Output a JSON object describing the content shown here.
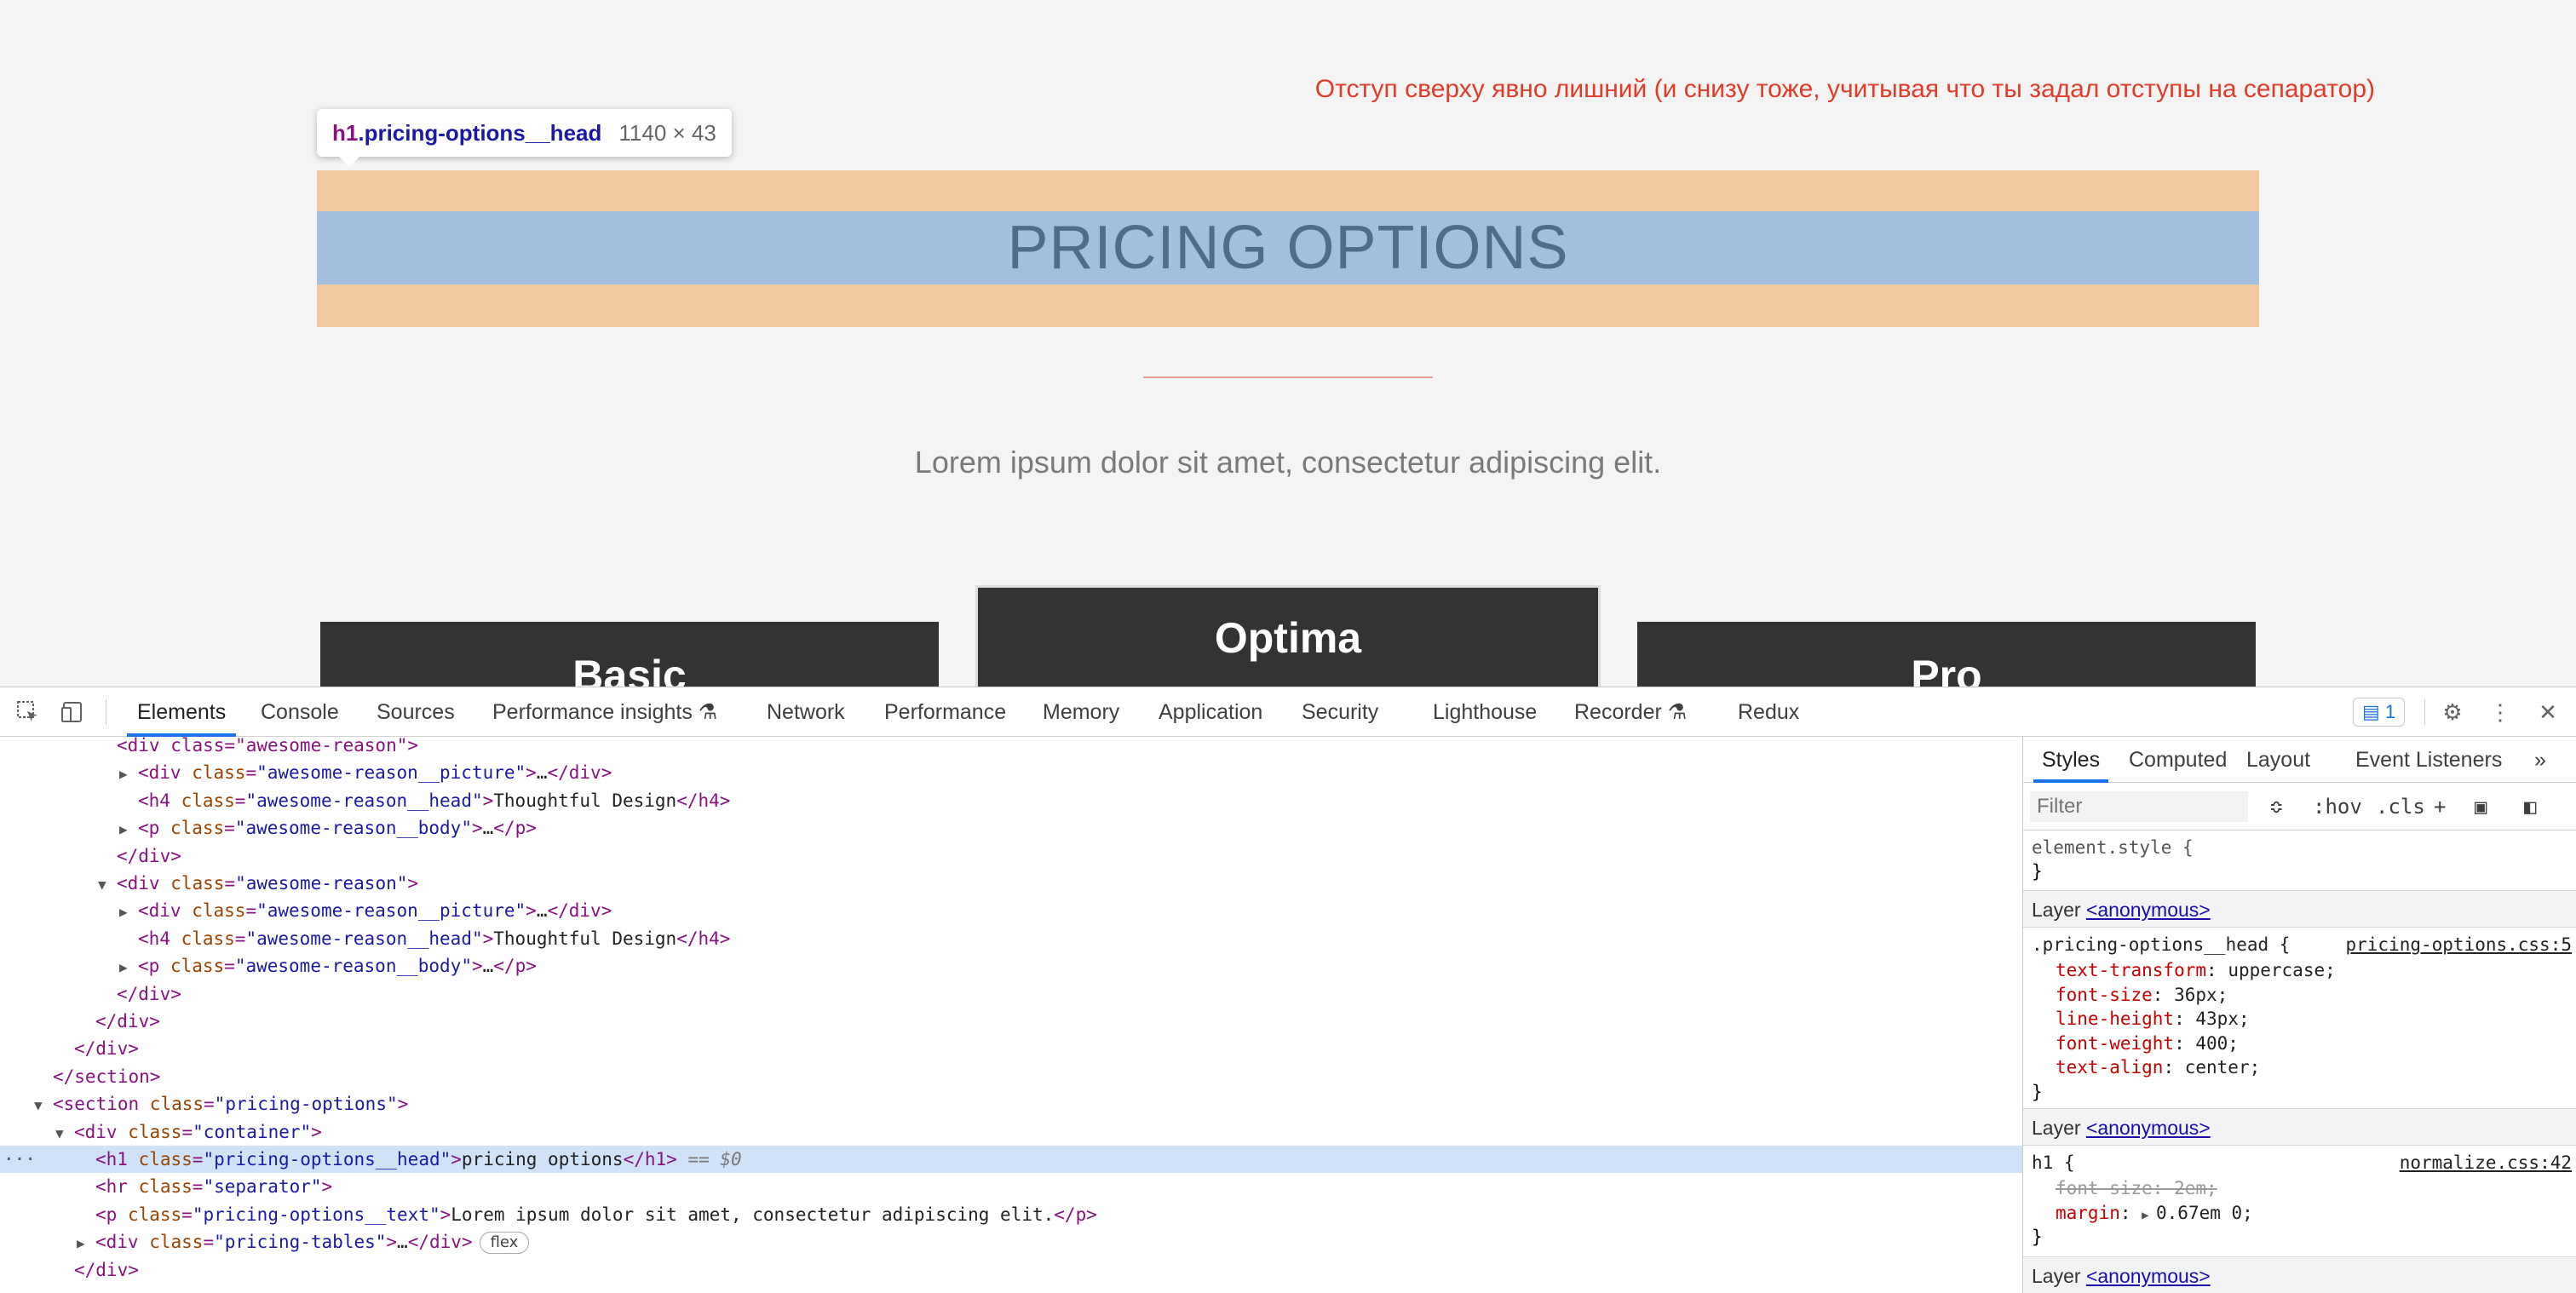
{
  "page": {
    "annotation": "Отступ сверху явно лишний (и снизу тоже, учитывая что ты задал отступы на сепаратор)",
    "tooltip": {
      "tag": "h1",
      "class": ".pricing-options__head",
      "size": "1140 × 43"
    },
    "title": "PRICING OPTIONS",
    "lead": "Lorem ipsum dolor sit amet, consectetur adipiscing elit.",
    "cards": [
      "Basic",
      "Optima",
      "Pro"
    ]
  },
  "devtools": {
    "tabs": [
      "Elements",
      "Console",
      "Sources",
      "Performance insights",
      "Network",
      "Performance",
      "Memory",
      "Application",
      "Security",
      "Lighthouse",
      "Recorder",
      "Redux"
    ],
    "active_tab": "Elements",
    "issues_count": "1",
    "dom": [
      {
        "indent": 4,
        "tri": "",
        "html": "partial"
      },
      {
        "indent": 5,
        "tri": "▶",
        "tag": "div",
        "cls": "awesome-reason__picture",
        "inner": "…",
        "close": true
      },
      {
        "indent": 5,
        "tri": "",
        "tag": "h4",
        "cls": "awesome-reason__head",
        "inner": "Thoughtful Design",
        "close": true
      },
      {
        "indent": 5,
        "tri": "▶",
        "tag": "p",
        "cls": "awesome-reason__body",
        "inner": "…",
        "close": true
      },
      {
        "indent": 4,
        "tri": "",
        "closing": "div"
      },
      {
        "indent": 4,
        "tri": "▼",
        "tag": "div",
        "cls": "awesome-reason",
        "open": true
      },
      {
        "indent": 5,
        "tri": "▶",
        "tag": "div",
        "cls": "awesome-reason__picture",
        "inner": "…",
        "close": true
      },
      {
        "indent": 5,
        "tri": "",
        "tag": "h4",
        "cls": "awesome-reason__head",
        "inner": "Thoughtful Design",
        "close": true
      },
      {
        "indent": 5,
        "tri": "▶",
        "tag": "p",
        "cls": "awesome-reason__body",
        "inner": "…",
        "close": true
      },
      {
        "indent": 4,
        "tri": "",
        "closing": "div"
      },
      {
        "indent": 3,
        "tri": "",
        "closing": "div"
      },
      {
        "indent": 2,
        "tri": "",
        "closing": "div"
      },
      {
        "indent": 1,
        "tri": "",
        "closing": "section"
      },
      {
        "indent": 1,
        "tri": "▼",
        "tag": "section",
        "cls": "pricing-options",
        "open": true
      },
      {
        "indent": 2,
        "tri": "▼",
        "tag": "div",
        "cls": "container",
        "open": true
      },
      {
        "indent": 3,
        "tri": "",
        "tag": "h1",
        "cls": "pricing-options__head",
        "inner": "pricing options",
        "close": true,
        "selected": true,
        "marker": "== $0"
      },
      {
        "indent": 3,
        "tri": "",
        "tag": "hr",
        "cls": "separator",
        "open": true
      },
      {
        "indent": 3,
        "tri": "",
        "tag": "p",
        "cls": "pricing-options__text",
        "inner": "Lorem ipsum dolor sit amet, consectetur adipiscing elit.",
        "close": true
      },
      {
        "indent": 3,
        "tri": "▶",
        "tag": "div",
        "cls": "pricing-tables",
        "inner": "…",
        "close": true,
        "badge": "flex"
      },
      {
        "indent": 2,
        "tri": "",
        "closing": "div"
      }
    ],
    "partial_line": "<div class=\"awesome-reason\">",
    "styles": {
      "tabs": [
        "Styles",
        "Computed",
        "Layout",
        "Event Listeners"
      ],
      "filter_placeholder": "Filter",
      "hov": ":hov",
      "cls": ".cls",
      "element_style": "element.style {",
      "close_brace": "}",
      "layer_label": "Layer",
      "layer_link": "<anonymous>",
      "rule1": {
        "selector": ".pricing-options__head {",
        "source": "pricing-options.css:5",
        "props": [
          {
            "name": "text-transform",
            "value": "uppercase;"
          },
          {
            "name": "font-size",
            "value": "36px;"
          },
          {
            "name": "line-height",
            "value": "43px;"
          },
          {
            "name": "font-weight",
            "value": "400;"
          },
          {
            "name": "text-align",
            "value": "center;"
          }
        ]
      },
      "rule2": {
        "selector": "h1 {",
        "source": "normalize.css:42",
        "props": [
          {
            "name": "font-size",
            "value": "2em;",
            "overridden": true
          },
          {
            "name": "margin",
            "value": "0.67em 0;",
            "expandable": true
          }
        ]
      }
    }
  }
}
